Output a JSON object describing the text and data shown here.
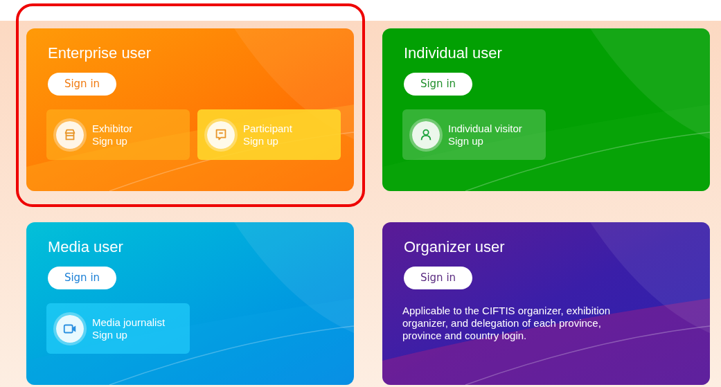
{
  "cards": [
    {
      "kind": "enterprise",
      "title": "Enterprise user",
      "highlighted": true,
      "button": "Sign in",
      "tiles": [
        {
          "name": "Exhibitor",
          "action": "Sign up"
        },
        {
          "name": "Participant",
          "action": "Sign up"
        }
      ]
    },
    {
      "kind": "individual",
      "title": "Individual user",
      "highlighted": false,
      "button": "Sign in",
      "tiles": [
        {
          "name": "Individual visitor",
          "action": "Sign up"
        }
      ]
    },
    {
      "kind": "media",
      "title": "Media user",
      "highlighted": false,
      "button": "Sign in",
      "tiles": [
        {
          "name": "Media journalist",
          "action": "Sign up"
        }
      ]
    },
    {
      "kind": "organizer",
      "title": "Organizer user",
      "highlighted": false,
      "button": "Sign in",
      "description": "Applicable to the CIFTIS organizer, exhibition organizer, and delegation of each province, province and country login."
    }
  ]
}
